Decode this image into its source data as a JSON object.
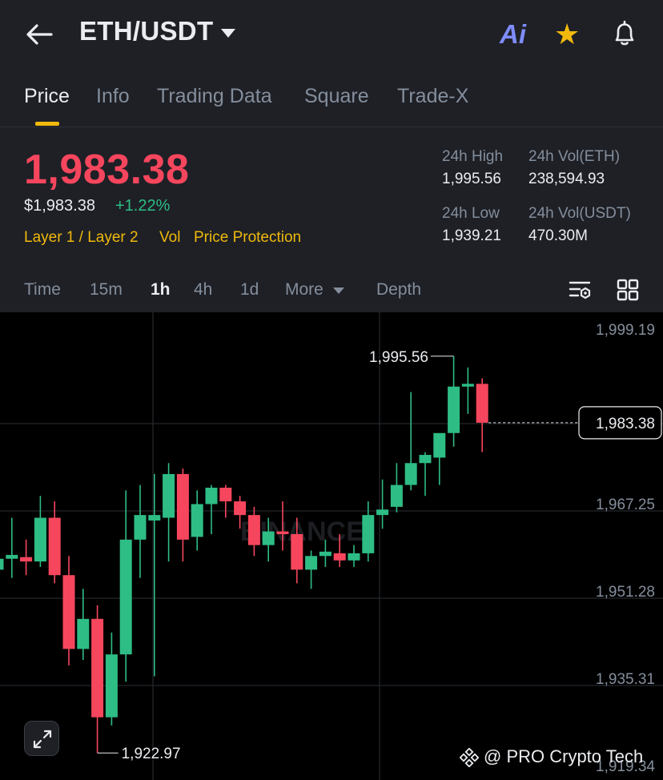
{
  "header": {
    "pair": "ETH/USDT",
    "ai_label": "Ai"
  },
  "tabs": [
    {
      "label": "Price"
    },
    {
      "label": "Info"
    },
    {
      "label": "Trading Data"
    },
    {
      "label": "Square"
    },
    {
      "label": "Trade-X"
    }
  ],
  "ticker": {
    "last_price": "1,983.38",
    "usd_price": "$1,983.38",
    "change_pct": "+1.22%",
    "tags": [
      "Layer 1 / Layer 2",
      "Vol",
      "Price Protection"
    ],
    "high_label": "24h High",
    "high_value": "1,995.56",
    "low_label": "24h Low",
    "low_value": "1,939.21",
    "vol_base_label": "24h Vol(ETH)",
    "vol_base_value": "238,594.93",
    "vol_quote_label": "24h Vol(USDT)",
    "vol_quote_value": "470.30M"
  },
  "intervals": [
    {
      "label": "Time"
    },
    {
      "label": "15m"
    },
    {
      "label": "1h"
    },
    {
      "label": "4h"
    },
    {
      "label": "1d"
    },
    {
      "label": "More"
    },
    {
      "label": "Depth"
    }
  ],
  "colors": {
    "up": "#2ebd85",
    "down": "#f6465d",
    "accent": "#f0b90b",
    "background": "#1e2026",
    "chart_background": "#000000"
  },
  "chart_data": {
    "type": "candlestick",
    "ylim": [
      1919.34,
      1999.19
    ],
    "y_ticks": [
      "1,999.19",
      "1,983.22",
      "1,967.25",
      "1,951.28",
      "1,935.31",
      "1,919.34"
    ],
    "current_price_label": "1,983.38",
    "current_price": 1983.38,
    "high_marker": {
      "label": "1,995.56",
      "value": 1995.56
    },
    "low_marker": {
      "label": "1,922.97",
      "value": 1922.97
    },
    "watermark": "BINANCE",
    "candles": [
      {
        "o": 1956.5,
        "h": 1962,
        "l": 1954,
        "c": 1958.5
      },
      {
        "o": 1958.5,
        "h": 1966,
        "l": 1955,
        "c": 1959.2
      },
      {
        "o": 1958.8,
        "h": 1962,
        "l": 1955.5,
        "c": 1958.0
      },
      {
        "o": 1958.0,
        "h": 1970,
        "l": 1957,
        "c": 1966.0
      },
      {
        "o": 1966.0,
        "h": 1969,
        "l": 1954,
        "c": 1955.5
      },
      {
        "o": 1955.5,
        "h": 1959,
        "l": 1939,
        "c": 1942.0
      },
      {
        "o": 1942.0,
        "h": 1953,
        "l": 1940,
        "c": 1947.5
      },
      {
        "o": 1947.5,
        "h": 1950,
        "l": 1922.97,
        "c": 1929.5
      },
      {
        "o": 1929.5,
        "h": 1945,
        "l": 1928,
        "c": 1941.0
      },
      {
        "o": 1941.0,
        "h": 1971,
        "l": 1936,
        "c": 1962.0
      },
      {
        "o": 1962.0,
        "h": 1972,
        "l": 1955,
        "c": 1966.5
      },
      {
        "o": 1965.5,
        "h": 1974,
        "l": 1937,
        "c": 1966.5
      },
      {
        "o": 1966.0,
        "h": 1976,
        "l": 1958,
        "c": 1974.0
      },
      {
        "o": 1974.0,
        "h": 1975,
        "l": 1958,
        "c": 1962.0
      },
      {
        "o": 1962.5,
        "h": 1971,
        "l": 1960,
        "c": 1968.5
      },
      {
        "o": 1968.5,
        "h": 1972,
        "l": 1963,
        "c": 1971.5
      },
      {
        "o": 1971.5,
        "h": 1972,
        "l": 1966,
        "c": 1969.0
      },
      {
        "o": 1969.0,
        "h": 1970,
        "l": 1964,
        "c": 1966.5
      },
      {
        "o": 1966.5,
        "h": 1968,
        "l": 1959,
        "c": 1961.0
      },
      {
        "o": 1961.0,
        "h": 1966,
        "l": 1958,
        "c": 1963.5
      },
      {
        "o": 1963.5,
        "h": 1969,
        "l": 1960,
        "c": 1963.0
      },
      {
        "o": 1963.0,
        "h": 1966,
        "l": 1954,
        "c": 1956.5
      },
      {
        "o": 1956.5,
        "h": 1960,
        "l": 1953,
        "c": 1959.0
      },
      {
        "o": 1959.0,
        "h": 1962,
        "l": 1957,
        "c": 1959.8
      },
      {
        "o": 1959.5,
        "h": 1963,
        "l": 1957,
        "c": 1958.2
      },
      {
        "o": 1958.2,
        "h": 1961,
        "l": 1957,
        "c": 1959.5
      },
      {
        "o": 1959.5,
        "h": 1969,
        "l": 1958,
        "c": 1966.5
      },
      {
        "o": 1966.5,
        "h": 1973,
        "l": 1964,
        "c": 1967.5
      },
      {
        "o": 1968.0,
        "h": 1976,
        "l": 1967,
        "c": 1972.0
      },
      {
        "o": 1972.0,
        "h": 1989,
        "l": 1971,
        "c": 1976.0
      },
      {
        "o": 1976.0,
        "h": 1978,
        "l": 1970,
        "c": 1977.5
      },
      {
        "o": 1977.0,
        "h": 1981,
        "l": 1972,
        "c": 1981.5
      },
      {
        "o": 1981.5,
        "h": 1995.56,
        "l": 1979,
        "c": 1990.0
      },
      {
        "o": 1990.0,
        "h": 1993.5,
        "l": 1985,
        "c": 1990.5
      },
      {
        "o": 1990.5,
        "h": 1991.5,
        "l": 1978,
        "c": 1983.38
      }
    ]
  },
  "watermark_credit": "@ PRO Crypto Tech"
}
